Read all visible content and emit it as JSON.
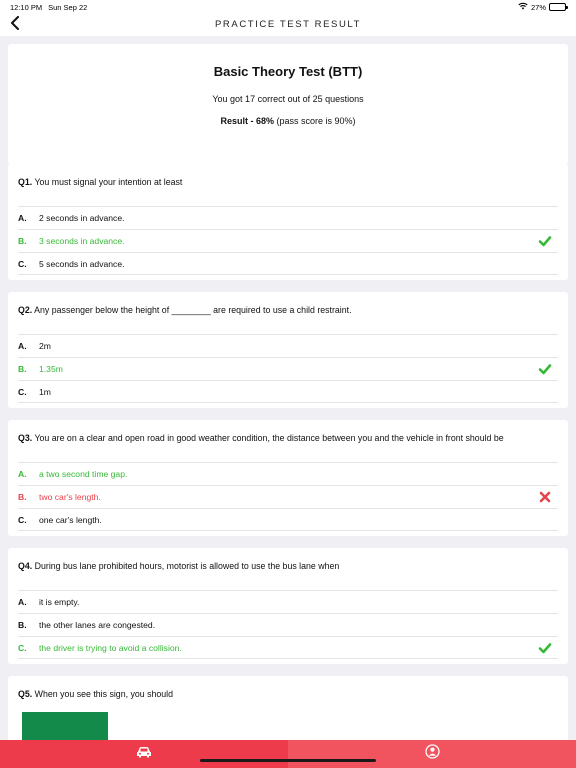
{
  "status_bar": {
    "time": "12:10 PM",
    "date": "Sun Sep 22",
    "battery": "27%",
    "battery_level": 0.27
  },
  "nav": {
    "title": "PRACTICE TEST RESULT",
    "back_icon": "chevron-left-icon"
  },
  "summary": {
    "title": "Basic Theory Test (BTT)",
    "score_line": "You got 17 correct out of 25 questions",
    "result_label": "Result - 68%",
    "pass_note": "(pass score is 90%)"
  },
  "questions": [
    {
      "number": "Q1.",
      "text": "You must signal your intention at least",
      "options": [
        {
          "letter": "A.",
          "text": "2 seconds in advance.",
          "state": "normal"
        },
        {
          "letter": "B.",
          "text": "3 seconds in advance.",
          "state": "correct-selected"
        },
        {
          "letter": "C.",
          "text": "5 seconds in advance.",
          "state": "normal"
        }
      ]
    },
    {
      "number": "Q2.",
      "text": "Any passenger below the height of ________ are required to use a child restraint.",
      "options": [
        {
          "letter": "A.",
          "text": "2m",
          "state": "normal"
        },
        {
          "letter": "B.",
          "text": "1.35m",
          "state": "correct-selected"
        },
        {
          "letter": "C.",
          "text": "1m",
          "state": "normal"
        }
      ]
    },
    {
      "number": "Q3.",
      "text": "You are on a clear and open road in good weather condition, the distance between you and the vehicle in front should be",
      "options": [
        {
          "letter": "A.",
          "text": "a two second time gap.",
          "state": "correct"
        },
        {
          "letter": "B.",
          "text": "two car's length.",
          "state": "wrong-selected"
        },
        {
          "letter": "C.",
          "text": "one car's length.",
          "state": "normal"
        }
      ]
    },
    {
      "number": "Q4.",
      "text": "During bus lane prohibited hours, motorist is allowed to use the bus lane when",
      "options": [
        {
          "letter": "A.",
          "text": "it is empty.",
          "state": "normal"
        },
        {
          "letter": "B.",
          "text": "the other lanes are congested.",
          "state": "normal"
        },
        {
          "letter": "C.",
          "text": "the driver is trying to avoid a collision.",
          "state": "correct-selected"
        }
      ]
    },
    {
      "number": "Q5.",
      "text": "When you see this sign, you should",
      "options": []
    }
  ],
  "tab_bar": {
    "tabs": [
      {
        "icon": "car-icon",
        "selected": true
      },
      {
        "icon": "person-icon",
        "selected": false
      }
    ]
  },
  "colors": {
    "correct": "#37b836",
    "wrong": "#e9434a",
    "tab_active": "#ee3b4b",
    "tab_inactive": "#f2545f"
  }
}
